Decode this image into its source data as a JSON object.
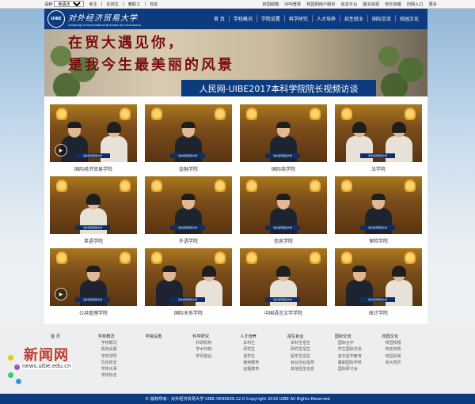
{
  "topbar": {
    "lang_label": "语种",
    "lang_selected": "英语法日韩西",
    "left_links": [
      "考生",
      "在校生",
      "教职工",
      "校友"
    ],
    "right_links": [
      "校园邮箱",
      "VPN登录",
      "校园网用户服务",
      "信息平台",
      "图书资源",
      "校长信箱",
      "旧网入口",
      "更多"
    ]
  },
  "header": {
    "logo_seal": "UIBE",
    "logo_cn": "对外经济贸易大学",
    "logo_en": "University of International Business and Economics",
    "nav": [
      "首 页",
      "学校概况",
      "学院设置",
      "科学研究",
      "人才培养",
      "招生就业",
      "国际交流",
      "校园文化"
    ]
  },
  "banner": {
    "calligraphy_line1": "在贸大遇见你，",
    "calligraphy_line2": "是我今生最美丽的风景",
    "title": "人民网-UIBE2017本科学院院长视频访谈"
  },
  "videos": [
    {
      "caption": "国际经济贸易学院",
      "people": [
        "m",
        "f"
      ],
      "play": true
    },
    {
      "caption": "金融学院",
      "people": [
        "m"
      ],
      "play": false
    },
    {
      "caption": "国际商学院",
      "people": [
        "m"
      ],
      "play": false
    },
    {
      "caption": "法学院",
      "people": [
        "f",
        "f"
      ],
      "play": false
    },
    {
      "caption": "英语学院",
      "people": [
        "f"
      ],
      "play": false
    },
    {
      "caption": "外语学院",
      "people": [
        "m"
      ],
      "play": false
    },
    {
      "caption": "信息学院",
      "people": [
        "m"
      ],
      "play": false
    },
    {
      "caption": "保险学院",
      "people": [
        "m"
      ],
      "play": false
    },
    {
      "caption": "公共管理学院",
      "people": [
        "m"
      ],
      "play": true
    },
    {
      "caption": "国际关系学院",
      "people": [
        "m",
        "f"
      ],
      "play": false
    },
    {
      "caption": "中国语言文学学院",
      "people": [
        "f"
      ],
      "play": false
    },
    {
      "caption": "统计学院",
      "people": [
        "m",
        "f"
      ],
      "play": false
    }
  ],
  "sign_text": "对外经济贸易大学",
  "footer": {
    "brand": "新闻网",
    "brand_url": "news.uibe.edu.cn",
    "columns": [
      {
        "title": "首 页",
        "items": []
      },
      {
        "title": "学校概况",
        "items": [
          "学校概况",
          "机构设置",
          "学校领导",
          "历任校长",
          "学校大事",
          "学校标志"
        ]
      },
      {
        "title": "学院设置",
        "items": []
      },
      {
        "title": "科学研究",
        "items": [
          "科研机构",
          "学术刊物",
          "学风建设"
        ]
      },
      {
        "title": "人才培养",
        "items": [
          "本科生",
          "研究生",
          "留学生",
          "继续教育",
          "远程教育"
        ]
      },
      {
        "title": "招生就业",
        "items": [
          "本科生招生",
          "研究生招生",
          "留学生招生",
          "就业创业指导",
          "其他招生信息"
        ]
      },
      {
        "title": "国际交流",
        "items": [
          "国际合作",
          "学生国际交流",
          "来华留学教育",
          "暑期国际学校",
          "国际研讨会"
        ]
      },
      {
        "title": "校园文化",
        "items": [
          "校园校报",
          "校史校情",
          "校园风景",
          "贸大校历"
        ]
      }
    ],
    "copyright": "© 版权所有：对外经济贸易大学 UIBE.VERSION.12.0 Copyright 2016 UIBE All Rights Reserved"
  },
  "colors": {
    "primary": "#0d3b80",
    "brand_red": "#c0392b"
  }
}
